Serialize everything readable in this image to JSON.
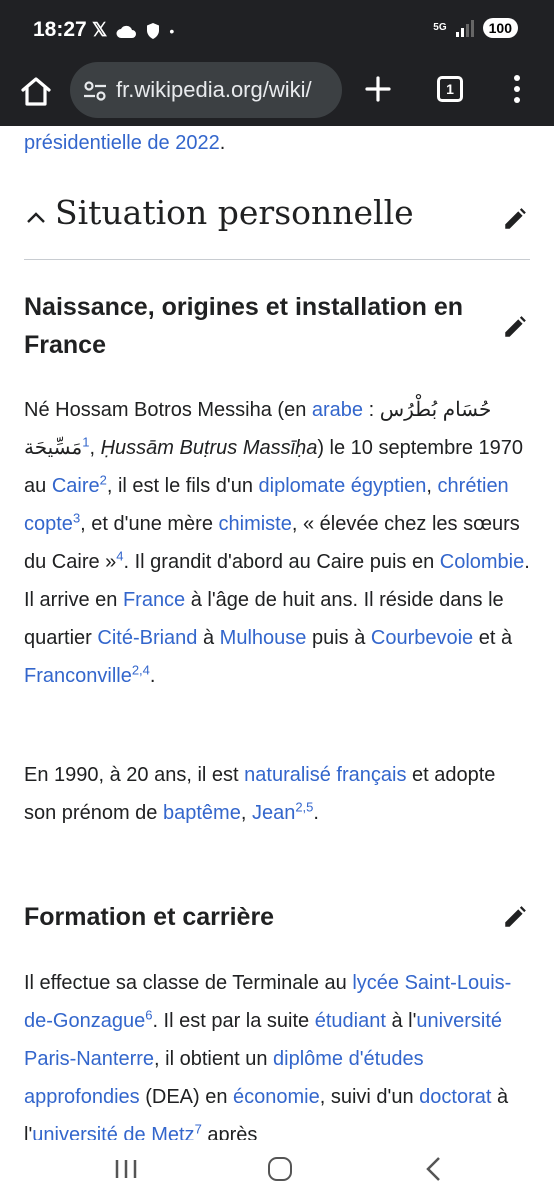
{
  "status": {
    "time": "18:27",
    "network": "5G",
    "battery": "100"
  },
  "browser": {
    "url": "fr.wikipedia.org/wiki/",
    "tab_count": "1"
  },
  "article": {
    "prev_link": "présidentielle de 2022",
    "prev_tail": ".",
    "section_title": "Situation personnelle",
    "sub1": {
      "title": "Naissance, origines et installation en France"
    },
    "p1": {
      "t1": "Né Hossam Botros Messiha (en ",
      "l_arabe": "arabe",
      "t2": " : ",
      "arabic": "حُسَام بُطْرُس مَسِّيحَة",
      "r1": "1",
      "t3": ", ",
      "translit": "Ḥussām Buṭrus Massīḥa",
      "t4": ") le 10 septembre 1970 au ",
      "l_caire": "Caire",
      "r2": "2",
      "t5": ", il est le fils d'un ",
      "l_diplomate": "diplomate égyptien",
      "t6": ", ",
      "l_copte": "chrétien copte",
      "r3": "3",
      "t7": ", et d'une mère ",
      "l_chimiste": "chimiste",
      "t8": ", « élevée chez les sœurs du Caire »",
      "r4": "4",
      "t9": ". Il grandit d'abord au Caire puis en ",
      "l_colombie": "Colombie",
      "t10": ". Il arrive en ",
      "l_france": "France",
      "t11": " à l'âge de huit ans. Il réside dans le quartier ",
      "l_cite": "Cité-Briand",
      "t12": " à ",
      "l_mulhouse": "Mulhouse",
      "t13": " puis à ",
      "l_courbevoie": "Courbevoie",
      "t14": " et à ",
      "l_franconville": "Franconville",
      "r5": "2,4",
      "t15": "."
    },
    "p2": {
      "t1": "En 1990, à 20 ans, il est ",
      "l_naturalise": "naturalisé français",
      "t2": " et adopte son prénom de ",
      "l_bapteme": "baptême",
      "t3": ", ",
      "l_jean": "Jean",
      "r1": "2,5",
      "t4": "."
    },
    "sub2": {
      "title": "Formation et carrière"
    },
    "p3": {
      "t1": "Il effectue sa classe de Terminale au ",
      "l_lycee": "lycée Saint-Louis-de-Gonzague",
      "r1": "6",
      "t2": ". Il est par la suite ",
      "l_etudiant": "étudiant",
      "t3": " à l'",
      "l_univ": "université Paris-Nanterre",
      "t4": ", il obtient un ",
      "l_dea": "diplôme d'études approfondies",
      "t5": " (DEA) en ",
      "l_eco": "économie",
      "t6": ", suivi d'un ",
      "l_doctorat": "doctorat",
      "t7": " à l'",
      "l_metz": "université de Metz",
      "r2": "7",
      "t8": " après"
    }
  }
}
